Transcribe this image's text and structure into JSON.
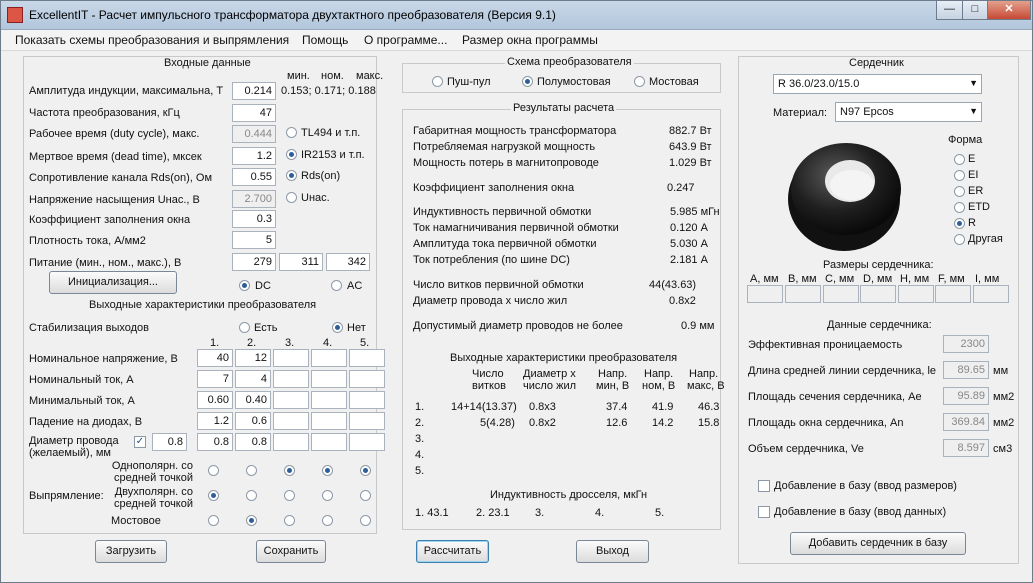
{
  "window": {
    "title": "ExcellentIT - Расчет импульсного трансформатора двухтактного преобразователя (Версия 9.1)",
    "buttons": [
      "—",
      "□",
      "✕"
    ]
  },
  "menu": [
    "Показать схемы преобразования и выпрямления",
    "Помощь",
    "О программе...",
    "Размер окна программы"
  ],
  "input": {
    "title": "Входные данные",
    "hdr_min": "мин.",
    "hdr_nom": "ном.",
    "hdr_max": "макс.",
    "rows": [
      {
        "label": "Амплитуда индукции, максимальна, Т",
        "value": "0.214",
        "extra": "0.153; 0.171; 0.188"
      },
      {
        "label": "Частота преобразования, кГц",
        "value": "47"
      },
      {
        "label": "Рабочее время (duty cycle), макс.",
        "value": "0.444",
        "extra": "TL494 и т.п."
      },
      {
        "label": "Мертвое время (dead time), мксек",
        "value": "1.2",
        "extra": "IR2153 и т.п."
      },
      {
        "label": "Сопротивление канала Rds(on), Ом",
        "value": "0.55",
        "extra": "Rds(on)"
      },
      {
        "label": "Напряжение насыщения Uнас., В",
        "value": "2.700",
        "extra": "Uнас."
      },
      {
        "label": "Коэффициент заполнения окна",
        "value": "0.3"
      },
      {
        "label": "Плотность тока, А/мм2",
        "value": "5"
      },
      {
        "label": "Питание (мин., ном., макс.), В",
        "values": [
          "279",
          "311",
          "342"
        ]
      }
    ],
    "init_button": "Инициализация...",
    "dc": "DC",
    "ac": "AC"
  },
  "output": {
    "title": "Выходные характеристики преобразователя",
    "stab_label": "Стабилизация выходов",
    "yes": "Есть",
    "no": "Нет",
    "cols": [
      "1.",
      "2.",
      "3.",
      "4.",
      "5."
    ],
    "rows": [
      {
        "label": "Номинальное напряжение, В",
        "values": [
          "40",
          "12",
          "",
          "",
          ""
        ]
      },
      {
        "label": "Номинальный ток, А",
        "values": [
          "7",
          "4",
          "",
          "",
          ""
        ]
      },
      {
        "label": "Минимальный ток, А",
        "values": [
          "0.60",
          "0.40",
          "",
          "",
          ""
        ]
      },
      {
        "label": "Падение на диодах, В",
        "values": [
          "1.2",
          "0.6",
          "",
          "",
          ""
        ]
      },
      {
        "label": "Диаметр провода (желаемый), мм",
        "desired": "0.8",
        "values": [
          "0.8",
          "0.8",
          "",
          "",
          ""
        ]
      }
    ],
    "rect_label": "Выпрямление:",
    "rect_opts": [
      "Однополярн. со средней точкой",
      "Двухполярн. со средней точкой",
      "Мостовое"
    ]
  },
  "scheme": {
    "title": "Схема преобразователя",
    "opts": [
      "Пуш-пул",
      "Полумостовая",
      "Мостовая"
    ]
  },
  "results": {
    "title": "Результаты расчета",
    "rows": [
      {
        "label": "Габаритная мощность трансформатора",
        "value": "882.7 Вт"
      },
      {
        "label": "Потребляемая нагрузкой мощность",
        "value": "643.9 Вт"
      },
      {
        "label": "Мощность потерь в магнитопроводе",
        "value": "1.029 Вт"
      },
      {
        "label": "Коэффициент заполнения окна",
        "value": "0.247"
      },
      {
        "label": "Индуктивность первичной обмотки",
        "value": "5.985 мГн"
      },
      {
        "label": "Ток намагничивания первичной обмотки",
        "value": "0.120 А"
      },
      {
        "label": "Амплитуда тока первичной обмотки",
        "value": "5.030 А"
      },
      {
        "label": "Ток потребления (по шине DC)",
        "value": "2.181 А"
      },
      {
        "label": "Число витков первичной обмотки",
        "value": "44(43.63)"
      },
      {
        "label": "Диаметр провода х число жил",
        "value": "0.8x2"
      },
      {
        "label": "Допустимый диаметр проводов не более",
        "value": "0.9 мм"
      }
    ],
    "out_title": "Выходные характеристики преобразователя",
    "out_headers": [
      [
        "Число",
        "витков"
      ],
      [
        "Диаметр х",
        "число жил"
      ],
      [
        "Напр.",
        "мин, В"
      ],
      [
        "Напр.",
        "ном, В"
      ],
      [
        "Напр.",
        "макс, В"
      ]
    ],
    "out_rows": [
      [
        "1.",
        "14+14(13.37)",
        "0.8x3",
        "37.4",
        "41.9",
        "46.3"
      ],
      [
        "2.",
        "5(4.28)",
        "0.8x2",
        "12.6",
        "14.2",
        "15.8"
      ],
      [
        "3.",
        "",
        "",
        "",
        "",
        ""
      ],
      [
        "4.",
        "",
        "",
        "",
        "",
        ""
      ],
      [
        "5.",
        "",
        "",
        "",
        "",
        ""
      ]
    ],
    "ind_title": "Индуктивность дросселя, мкГн",
    "ind_vals": [
      "1. 43.1",
      "2. 23.1",
      "3.",
      "4.",
      "5."
    ]
  },
  "core": {
    "title": "Сердечник",
    "selected": "R 36.0/23.0/15.0",
    "material_label": "Материал:",
    "material": "N97 Epcos",
    "form_title": "Форма",
    "forms": [
      "E",
      "EI",
      "ER",
      "ETD",
      "R",
      "Другая"
    ],
    "dims_title": "Размеры сердечника:",
    "dims": [
      "A, мм",
      "B, мм",
      "C, мм",
      "D, мм",
      "H, мм",
      "F, мм",
      "I, мм"
    ],
    "data_title": "Данные сердечника:",
    "data": [
      {
        "label": "Эффективная проницаемость",
        "value": "2300",
        "unit": ""
      },
      {
        "label": "Длина средней линии сердечника, le",
        "value": "89.65",
        "unit": "мм"
      },
      {
        "label": "Площадь сечения сердечника, Ae",
        "value": "95.89",
        "unit": "мм2"
      },
      {
        "label": "Площадь окна сердечника, An",
        "value": "369.84",
        "unit": "мм2"
      },
      {
        "label": "Объем сердечника, Ve",
        "value": "8.597",
        "unit": "см3"
      }
    ],
    "add_dims": "Добавление в базу (ввод размеров)",
    "add_data": "Добавление в базу (ввод данных)",
    "add_button": "Добавить сердечник в базу"
  },
  "buttons": {
    "load": "Загрузить",
    "save": "Сохранить",
    "calc": "Рассчитать",
    "exit": "Выход"
  }
}
